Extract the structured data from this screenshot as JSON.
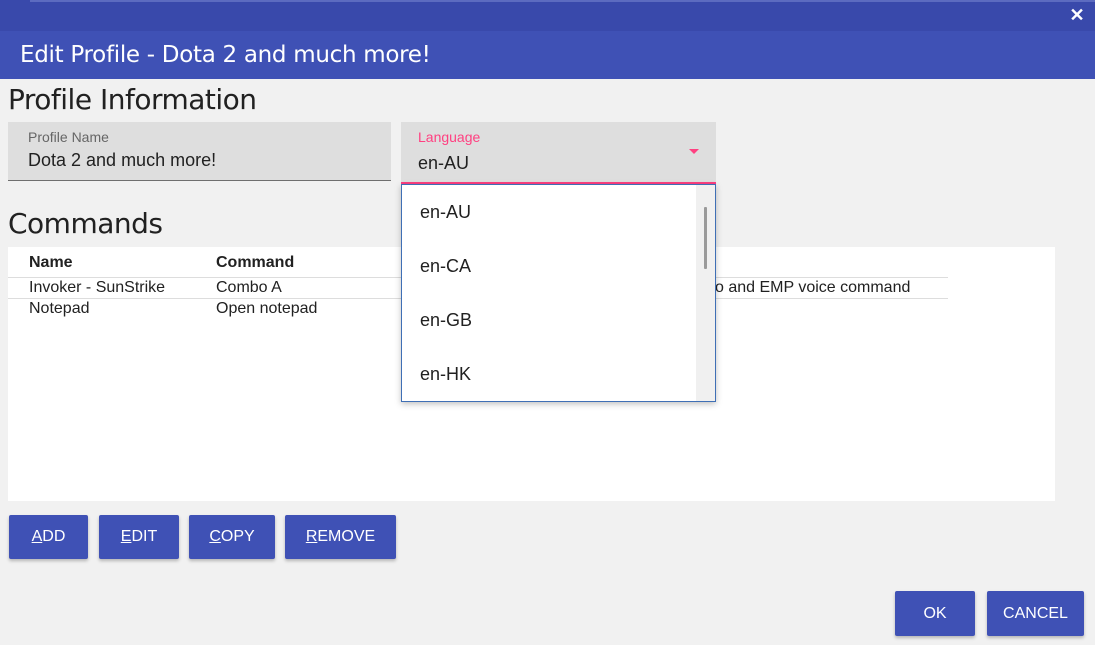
{
  "window": {
    "close_glyph": "✕",
    "title": "Edit Profile - Dota 2 and much more!"
  },
  "profile_section": {
    "heading": "Profile Information",
    "name_field": {
      "label": "Profile Name",
      "value": "Dota 2 and much more!"
    },
    "language_field": {
      "label": "Language",
      "value": "en-AU",
      "icon": "dropdown-arrow-icon",
      "accent_color": "#ff4081"
    }
  },
  "language_dropdown": {
    "options": [
      "en-AU",
      "en-CA",
      "en-GB",
      "en-HK"
    ]
  },
  "commands_section": {
    "heading": "Commands",
    "columns": [
      "Name",
      "Command"
    ],
    "rows": [
      {
        "name": "Invoker - SunStrike",
        "command": "Combo A",
        "extra": "o and EMP voice command"
      },
      {
        "name": "Notepad",
        "command": "Open notepad"
      }
    ]
  },
  "command_buttons": [
    {
      "mnemonic": "A",
      "rest": "DD"
    },
    {
      "mnemonic": "E",
      "rest": "DIT"
    },
    {
      "mnemonic": "C",
      "rest": "OPY"
    },
    {
      "mnemonic": "R",
      "rest": "EMOVE"
    }
  ],
  "dialog_buttons": {
    "ok": "OK",
    "cancel": "CANCEL"
  },
  "colors": {
    "primary": "#3f51b5",
    "header": "#3949ab",
    "accent": "#ff4081"
  }
}
